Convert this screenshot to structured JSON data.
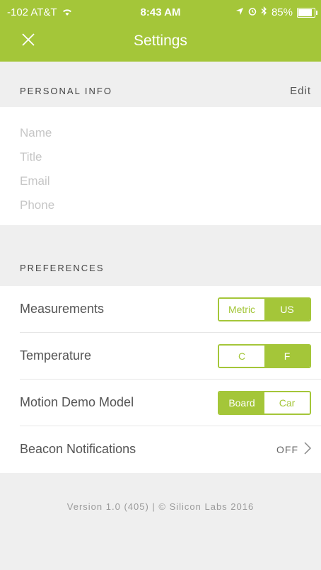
{
  "status_bar": {
    "carrier": "-102 AT&T",
    "time": "8:43 AM",
    "battery": "85%"
  },
  "nav": {
    "title": "Settings",
    "close_icon": "close-icon"
  },
  "personal_info": {
    "header": "PERSONAL INFO",
    "edit_label": "Edit",
    "fields": [
      "Name",
      "Title",
      "Email",
      "Phone"
    ]
  },
  "preferences": {
    "header": "PREFERENCES",
    "rows": [
      {
        "label": "Measurements",
        "options": [
          "Metric",
          "US"
        ],
        "selected": "US"
      },
      {
        "label": "Temperature",
        "options": [
          "C",
          "F"
        ],
        "selected": "F"
      },
      {
        "label": "Motion Demo Model",
        "options": [
          "Board",
          "Car"
        ],
        "selected": "Board"
      },
      {
        "label": "Beacon Notifications",
        "value": "OFF"
      }
    ]
  },
  "footer": {
    "text": "Version  1.0 (405) | © Silicon Labs 2016"
  },
  "colors": {
    "accent": "#a4c639",
    "background": "#efefef"
  }
}
